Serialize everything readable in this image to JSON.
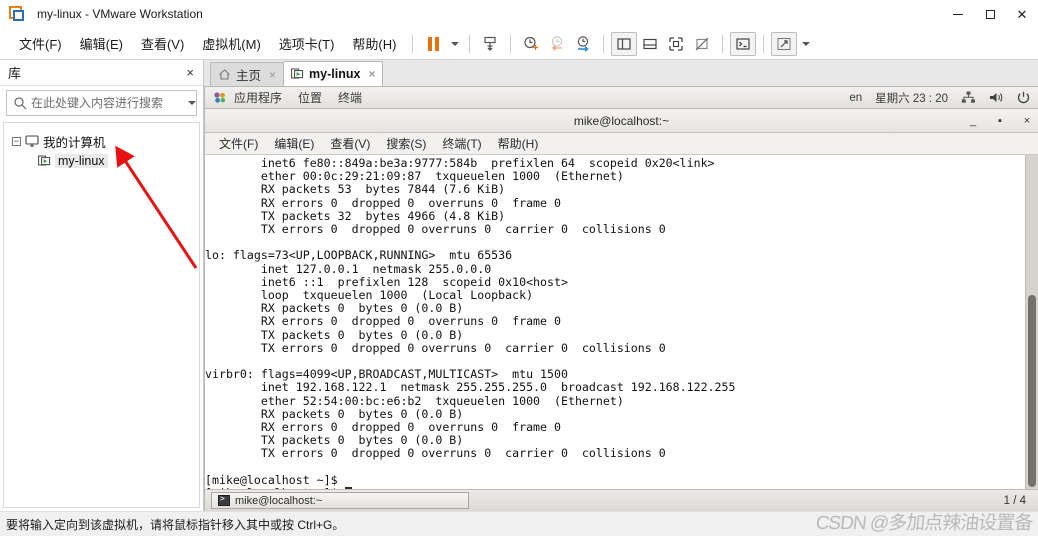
{
  "window": {
    "title": "my-linux - VMware Workstation",
    "app_icon": "vmware-icon",
    "minimize": "–",
    "maximize": "□",
    "close": "×"
  },
  "menubar": {
    "items": [
      {
        "label": "文件(F)",
        "name": "menu-file"
      },
      {
        "label": "编辑(E)",
        "name": "menu-edit"
      },
      {
        "label": "查看(V)",
        "name": "menu-view"
      },
      {
        "label": "虚拟机(M)",
        "name": "menu-vm"
      },
      {
        "label": "选项卡(T)",
        "name": "menu-tabs"
      },
      {
        "label": "帮助(H)",
        "name": "menu-help"
      }
    ]
  },
  "toolbar": {
    "buttons": [
      "pause-icon",
      "dropdown-caret-icon",
      "snapshot-icon",
      "take-snapshot-icon",
      "revert-snapshot-icon",
      "snapshot-manager-icon",
      "show-library-icon",
      "show-console-view-icon",
      "show-thumbnails-icon",
      "hide-thumbnails-icon",
      "send-ctrl-alt-del-icon",
      "fullscreen-icon",
      "fullscreen-caret-icon"
    ]
  },
  "sidebar": {
    "title": "库",
    "close_label": "×",
    "search": {
      "placeholder": "在此处键入内容进行搜索",
      "value": "",
      "icon": "search-icon",
      "dropdown_icon": "chevron-down-icon"
    },
    "tree": [
      {
        "label": "我的计算机",
        "icon": "computer-icon",
        "expander": "−",
        "level": 0
      },
      {
        "label": "my-linux",
        "icon": "vm-powered-on-icon",
        "level": 1,
        "selected": true
      }
    ]
  },
  "tabs": [
    {
      "label": "主页",
      "icon": "home-icon",
      "active": false,
      "close": "×"
    },
    {
      "label": "my-linux",
      "icon": "vm-powered-on-icon",
      "active": true,
      "close": "×"
    }
  ],
  "guest": {
    "top_panel": {
      "menus": [
        "应用程序",
        "位置",
        "终端"
      ],
      "app_icon": "gnome-applications-icon",
      "keyboard_layout": "en",
      "clock": "星期六 23 : 20",
      "tray": [
        "network-icon",
        "volume-icon",
        "power-icon"
      ]
    },
    "terminal": {
      "title": "mike@localhost:~",
      "controls": {
        "minimize": "_",
        "maximize": "▪",
        "close": "×"
      },
      "menus": [
        "文件(F)",
        "编辑(E)",
        "查看(V)",
        "搜索(S)",
        "终端(T)",
        "帮助(H)"
      ],
      "lines": [
        "        inet6 fe80::849a:be3a:9777:584b  prefixlen 64  scopeid 0x20<link>",
        "        ether 00:0c:29:21:09:87  txqueuelen 1000  (Ethernet)",
        "        RX packets 53  bytes 7844 (7.6 KiB)",
        "        RX errors 0  dropped 0  overruns 0  frame 0",
        "        TX packets 32  bytes 4966 (4.8 KiB)",
        "        TX errors 0  dropped 0 overruns 0  carrier 0  collisions 0",
        "",
        "lo: flags=73<UP,LOOPBACK,RUNNING>  mtu 65536",
        "        inet 127.0.0.1  netmask 255.0.0.0",
        "        inet6 ::1  prefixlen 128  scopeid 0x10<host>",
        "        loop  txqueuelen 1000  (Local Loopback)",
        "        RX packets 0  bytes 0 (0.0 B)",
        "        RX errors 0  dropped 0  overruns 0  frame 0",
        "        TX packets 0  bytes 0 (0.0 B)",
        "        TX errors 0  dropped 0 overruns 0  carrier 0  collisions 0",
        "",
        "virbr0: flags=4099<UP,BROADCAST,MULTICAST>  mtu 1500",
        "        inet 192.168.122.1  netmask 255.255.255.0  broadcast 192.168.122.255",
        "        ether 52:54:00:bc:e6:b2  txqueuelen 1000  (Ethernet)",
        "        RX packets 0  bytes 0 (0.0 B)",
        "        RX errors 0  dropped 0  overruns 0  frame 0",
        "        TX packets 0  bytes 0 (0.0 B)",
        "        TX errors 0  dropped 0 overruns 0  carrier 0  collisions 0",
        "",
        "[mike@localhost ~]$"
      ],
      "prompt_last": "[mike@localhost ~]$ "
    },
    "taskbar": {
      "window_button": "mike@localhost:~",
      "window_icon": "terminal-icon",
      "workspace_indicator": "1 / 4"
    }
  },
  "statusbar": {
    "message": "要将输入定向到该虚拟机，请将鼠标指针移入其中或按 Ctrl+G。"
  },
  "annotations": {
    "arrow_color": "#e81010",
    "watermark": "CSDN @多加点辣油设置备"
  }
}
